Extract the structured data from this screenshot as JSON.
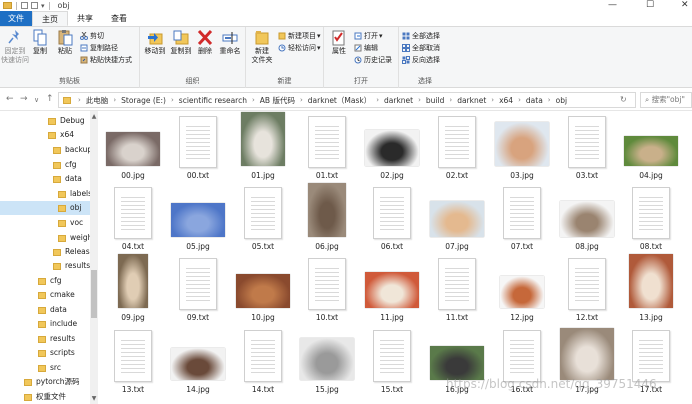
{
  "window": {
    "title": "obj"
  },
  "tabs": [
    {
      "label": "文件"
    },
    {
      "label": "主页"
    },
    {
      "label": "共享"
    },
    {
      "label": "查看"
    }
  ],
  "ribbon": {
    "clipboard": {
      "pin": "固定到\n快速访问",
      "copy": "复制",
      "paste": "粘贴",
      "cut": "剪切",
      "copy_path": "复制路径",
      "paste_shortcut": "粘贴快捷方式",
      "label": "剪贴板"
    },
    "organize": {
      "move_to": "移动到",
      "copy_to": "复制到",
      "delete": "删除",
      "rename": "重命名",
      "label": "组织"
    },
    "new": {
      "new_folder": "新建\n文件夹",
      "new_item": "新建项目",
      "easy_access": "轻松访问",
      "label": "新建"
    },
    "open": {
      "properties": "属性",
      "open": "打开",
      "edit": "编辑",
      "history": "历史记录",
      "label": "打开"
    },
    "select": {
      "select_all": "全部选择",
      "select_none": "全部取消",
      "invert": "反向选择",
      "label": "选择"
    }
  },
  "address": {
    "breadcrumbs": [
      "此电脑",
      "Storage (E:)",
      "scientific research",
      "AB 版代码",
      "darknet（Mask）",
      "darknet",
      "build",
      "darknet",
      "x64",
      "data",
      "obj"
    ],
    "search_placeholder": "搜索\"obj\""
  },
  "nav": {
    "items": [
      "Debug",
      "x64",
      "backup",
      "cfg",
      "data",
      "labels",
      "obj",
      "voc",
      "weights",
      "Release",
      "results",
      "cfg",
      "cmake",
      "data",
      "include",
      "results",
      "scripts",
      "src",
      "pytorch源码",
      "权重文件"
    ],
    "selected": "obj"
  },
  "files": [
    {
      "name": "00.jpg",
      "type": "img",
      "colors": [
        "#7a6a66",
        "#d9d2cc"
      ]
    },
    {
      "name": "00.txt",
      "type": "txt"
    },
    {
      "name": "01.jpg",
      "type": "img",
      "colors": [
        "#6d7d63",
        "#e7e3dc"
      ]
    },
    {
      "name": "01.txt",
      "type": "txt"
    },
    {
      "name": "02.jpg",
      "type": "img",
      "colors": [
        "#f2f2f2",
        "#2a2a2a"
      ]
    },
    {
      "name": "02.txt",
      "type": "txt"
    },
    {
      "name": "03.jpg",
      "type": "img",
      "colors": [
        "#dfe7ef",
        "#d8a37e"
      ]
    },
    {
      "name": "03.txt",
      "type": "txt"
    },
    {
      "name": "04.jpg",
      "type": "img",
      "colors": [
        "#5f8a3c",
        "#c9b08a"
      ]
    },
    {
      "name": "04.txt",
      "type": "txt"
    },
    {
      "name": "05.jpg",
      "type": "img",
      "colors": [
        "#4e76c8",
        "#8aa6de"
      ]
    },
    {
      "name": "05.txt",
      "type": "txt"
    },
    {
      "name": "06.jpg",
      "type": "img",
      "colors": [
        "#9a8a7a",
        "#6e5a4a"
      ]
    },
    {
      "name": "06.txt",
      "type": "txt"
    },
    {
      "name": "07.jpg",
      "type": "img",
      "colors": [
        "#d8e2ea",
        "#e4b98f"
      ]
    },
    {
      "name": "07.txt",
      "type": "txt"
    },
    {
      "name": "08.jpg",
      "type": "img",
      "colors": [
        "#f4f4f4",
        "#9a8470"
      ]
    },
    {
      "name": "08.txt",
      "type": "txt"
    },
    {
      "name": "09.jpg",
      "type": "img",
      "colors": [
        "#7d6a52",
        "#e0cdb4"
      ]
    },
    {
      "name": "09.txt",
      "type": "txt"
    },
    {
      "name": "10.jpg",
      "type": "img",
      "colors": [
        "#8a4a2e",
        "#c07a4a"
      ]
    },
    {
      "name": "10.txt",
      "type": "txt"
    },
    {
      "name": "11.jpg",
      "type": "img",
      "colors": [
        "#d05a3a",
        "#f0e6d8"
      ]
    },
    {
      "name": "11.txt",
      "type": "txt"
    },
    {
      "name": "12.jpg",
      "type": "img",
      "colors": [
        "#f6f6f6",
        "#c6683a"
      ]
    },
    {
      "name": "12.txt",
      "type": "txt"
    },
    {
      "name": "13.jpg",
      "type": "img",
      "colors": [
        "#b05a3a",
        "#f0e0d0"
      ]
    },
    {
      "name": "13.txt",
      "type": "txt"
    },
    {
      "name": "14.jpg",
      "type": "img",
      "colors": [
        "#f2f2f2",
        "#6a4a3a"
      ]
    },
    {
      "name": "14.txt",
      "type": "txt"
    },
    {
      "name": "15.jpg",
      "type": "img",
      "colors": [
        "#e8e8e8",
        "#9a9a9a"
      ]
    },
    {
      "name": "15.txt",
      "type": "txt"
    },
    {
      "name": "16.jpg",
      "type": "img",
      "colors": [
        "#5a7a4a",
        "#3a3a3a"
      ]
    },
    {
      "name": "16.txt",
      "type": "txt"
    },
    {
      "name": "17.jpg",
      "type": "img",
      "colors": [
        "#9a8a7a",
        "#e8e0d8"
      ]
    },
    {
      "name": "17.txt",
      "type": "txt"
    }
  ],
  "watermark": "https://blog.csdn.net/qq_39751446"
}
